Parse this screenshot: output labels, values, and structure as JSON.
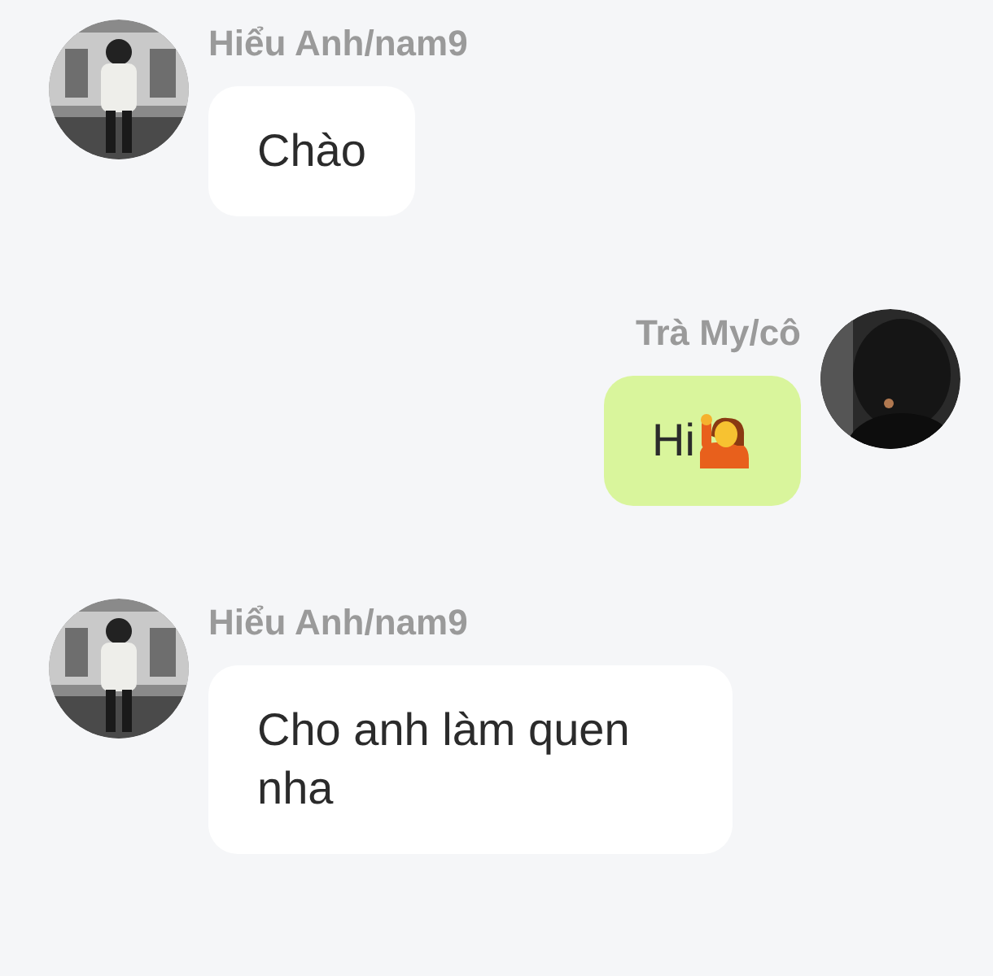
{
  "messages": [
    {
      "outgoing": false,
      "kind": "plain",
      "sender": "Hiểu Anh/nam9",
      "text": "Chào"
    },
    {
      "outgoing": true,
      "kind": "wave",
      "sender": "Trà My/cô",
      "text": "Hi"
    },
    {
      "outgoing": false,
      "kind": "plain",
      "sender": "Hiểu Anh/nam9",
      "text": "Cho anh làm quen nha"
    }
  ]
}
